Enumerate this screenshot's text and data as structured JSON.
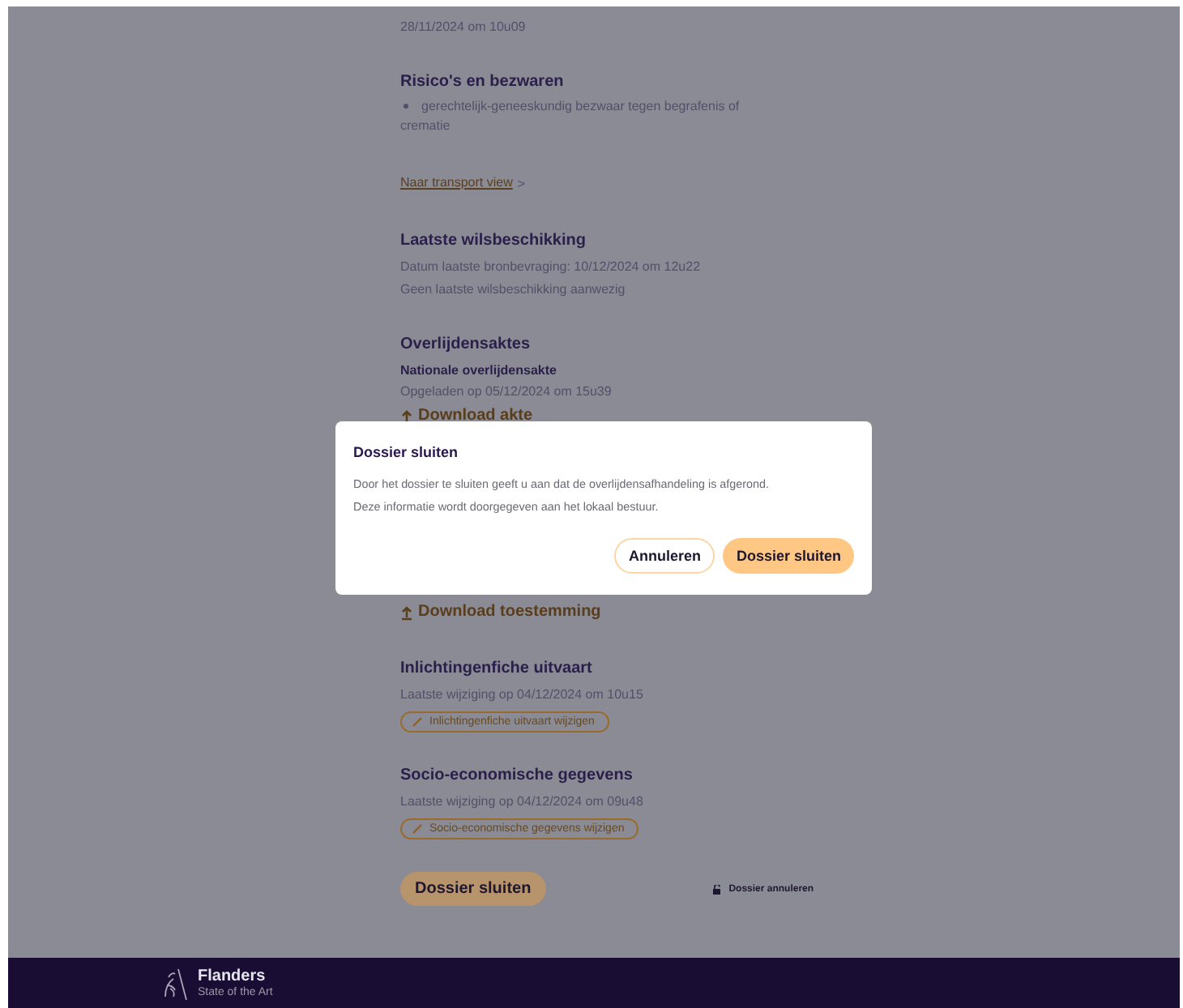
{
  "sections": [
    {
      "items": [
        {
          "kind": "text",
          "text": "28/11/2024 om 10u09"
        }
      ]
    },
    {
      "items": [
        {
          "kind": "heading",
          "text": "Risico's en bezwaren"
        },
        {
          "kind": "bullet",
          "text": "gerechtelijk-geneeskundig bezwaar tegen begrafenis of crematie"
        }
      ]
    },
    {
      "items": [
        {
          "kind": "link",
          "text": "Naar transport view",
          "icon": ">"
        }
      ]
    },
    {
      "items": [
        {
          "kind": "heading",
          "text": "Laatste wilsbeschikking"
        },
        {
          "kind": "text",
          "text": "Datum laatste bronbevraging: 10/12/2024 om 12u22"
        },
        {
          "kind": "text",
          "text": "Geen laatste wilsbeschikking aanwezig"
        }
      ]
    },
    {
      "items": [
        {
          "kind": "heading",
          "text": "Overlijdensaktes"
        },
        {
          "kind": "subheading",
          "text": "Nationale overlijdensakte"
        },
        {
          "kind": "text",
          "text": "Opgeladen op 05/12/2024 om 15u39"
        },
        {
          "kind": "download",
          "text": "Download akte"
        },
        {
          "kind": "hidden"
        },
        {
          "kind": "download",
          "text": "Download toestemming"
        }
      ]
    },
    {
      "items": [
        {
          "kind": "heading",
          "text": "Inlichtingenfiche uitvaart"
        },
        {
          "kind": "text",
          "text": "Laatste wijziging op 04/12/2024 om 10u15"
        },
        {
          "kind": "edit",
          "text": "Inlichtingenfiche uitvaart wijzigen"
        }
      ]
    },
    {
      "items": [
        {
          "kind": "heading",
          "text": "Socio-economische gegevens"
        },
        {
          "kind": "text",
          "text": "Laatste wijziging op 04/12/2024 om 09u48"
        },
        {
          "kind": "edit",
          "text": "Socio-economische gegevens wijzigen"
        }
      ]
    }
  ],
  "actions": {
    "primary": "Dossier sluiten",
    "secondary": "Dossier annuleren"
  },
  "modal": {
    "title": "Dossier sluiten",
    "body": [
      "Door het dossier te sluiten geeft u aan dat de overlijdensafhandeling is afgerond.",
      "Deze informatie wordt doorgegeven aan het lokaal bestuur."
    ],
    "cancel": "Annuleren",
    "confirm": "Dossier sluiten"
  },
  "footer": {
    "brand": "Flanders",
    "tagline": "State of the Art"
  }
}
